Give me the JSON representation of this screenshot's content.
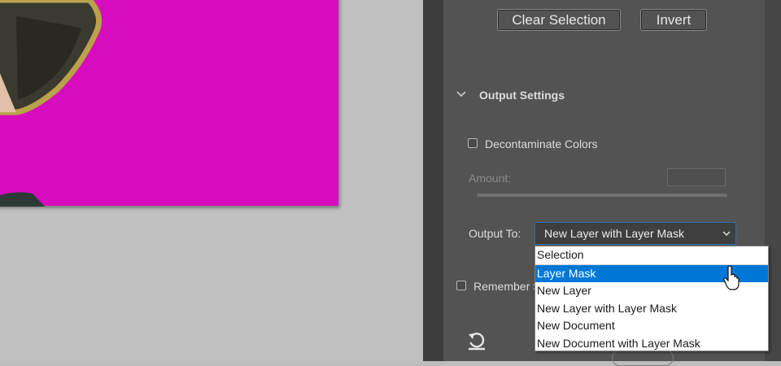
{
  "toolbar": {
    "clear_selection_label": "Clear Selection",
    "invert_label": "Invert"
  },
  "output_settings": {
    "title": "Output Settings",
    "decontaminate_label": "Decontaminate Colors",
    "decontaminate_checked": false,
    "amount_label": "Amount:",
    "amount_value": "",
    "output_to_label": "Output To:",
    "output_to_value": "New Layer with Layer Mask",
    "options": [
      "Selection",
      "Layer Mask",
      "New Layer",
      "New Layer with Layer Mask",
      "New Document",
      "New Document with Layer Mask"
    ],
    "highlighted_option": "Layer Mask",
    "remember_label": "Remember S",
    "remember_checked": false
  },
  "icons": {
    "section_toggle": "chevron-down-icon",
    "select_arrow": "chevron-down-icon",
    "reset": "reset-icon",
    "pointer": "mouse-cursor-icon"
  },
  "colors": {
    "overlay": "#d70cbe",
    "panel": "#535353",
    "highlight": "#0077d7"
  }
}
